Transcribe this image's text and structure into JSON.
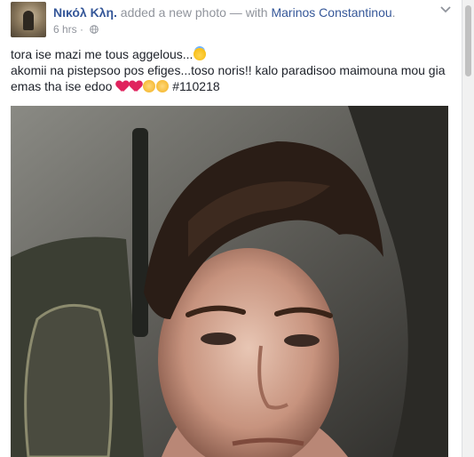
{
  "post": {
    "author": "Νικόλ Κλη.",
    "action": " added a new photo — with ",
    "tagged": "Marinos Constantinou",
    "tagged_suffix": ".",
    "timestamp": "6 hrs",
    "separator": " · ",
    "text_lines": [
      "tora ise mazi me tous aggelous...",
      "akomii na pistepsoo pos efiges...toso noris!! kalo paradisoo maimouna mou gia",
      "emas tha ise edoo "
    ],
    "hashtag": "#110218",
    "emojis": [
      "halo-emoji",
      "red-heart-emoji",
      "red-heart-emoji",
      "pensive-face-emoji",
      "pensive-face-emoji"
    ]
  },
  "colors": {
    "link": "#365899",
    "meta": "#90949c",
    "text": "#1d2129",
    "background": "#e9ebee"
  }
}
